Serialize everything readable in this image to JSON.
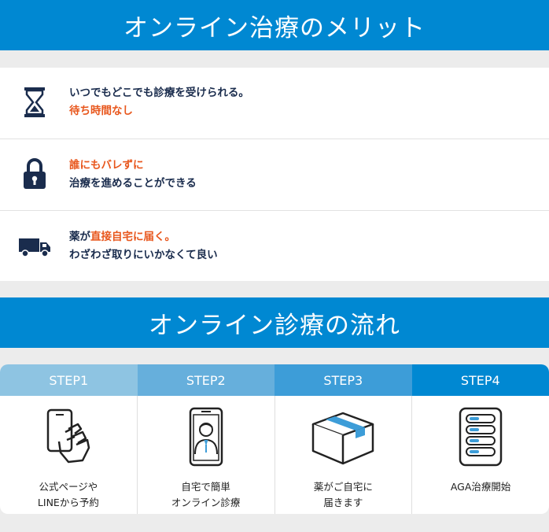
{
  "section1": {
    "title": "オンライン治療のメリット"
  },
  "merits": [
    {
      "icon": "hourglass-icon",
      "line1": "いつでもどこでも診療を受けられる。",
      "line2": "待ち時間なし"
    },
    {
      "icon": "lock-icon",
      "line1": "誰にもバレずに",
      "line2": "治療を進めることができる"
    },
    {
      "icon": "truck-icon",
      "line1_a": "薬が",
      "line1_b": "直接自宅に届く。",
      "line2": "わざわざ取りにいかなくて良い"
    }
  ],
  "section2": {
    "title": "オンライン診療の流れ"
  },
  "steps": [
    {
      "label": "STEP1",
      "icon": "smartphone-hand-icon",
      "caption1": "公式ページや",
      "caption2": "LINEから予約",
      "color": "#8ec4e2"
    },
    {
      "label": "STEP2",
      "icon": "doctor-phone-icon",
      "caption1": "自宅で簡単",
      "caption2": "オンライン診療",
      "color": "#66afdc"
    },
    {
      "label": "STEP3",
      "icon": "package-box-icon",
      "caption1": "薬がご自宅に",
      "caption2": "届きます",
      "color": "#3d9dd8"
    },
    {
      "label": "STEP4",
      "icon": "pill-pack-icon",
      "caption1": "AGA治療開始",
      "caption2": "",
      "color": "#0088d2"
    }
  ],
  "colors": {
    "brand_blue": "#0088d2",
    "accent_orange": "#e8571d",
    "text_navy": "#1a2c4d"
  }
}
